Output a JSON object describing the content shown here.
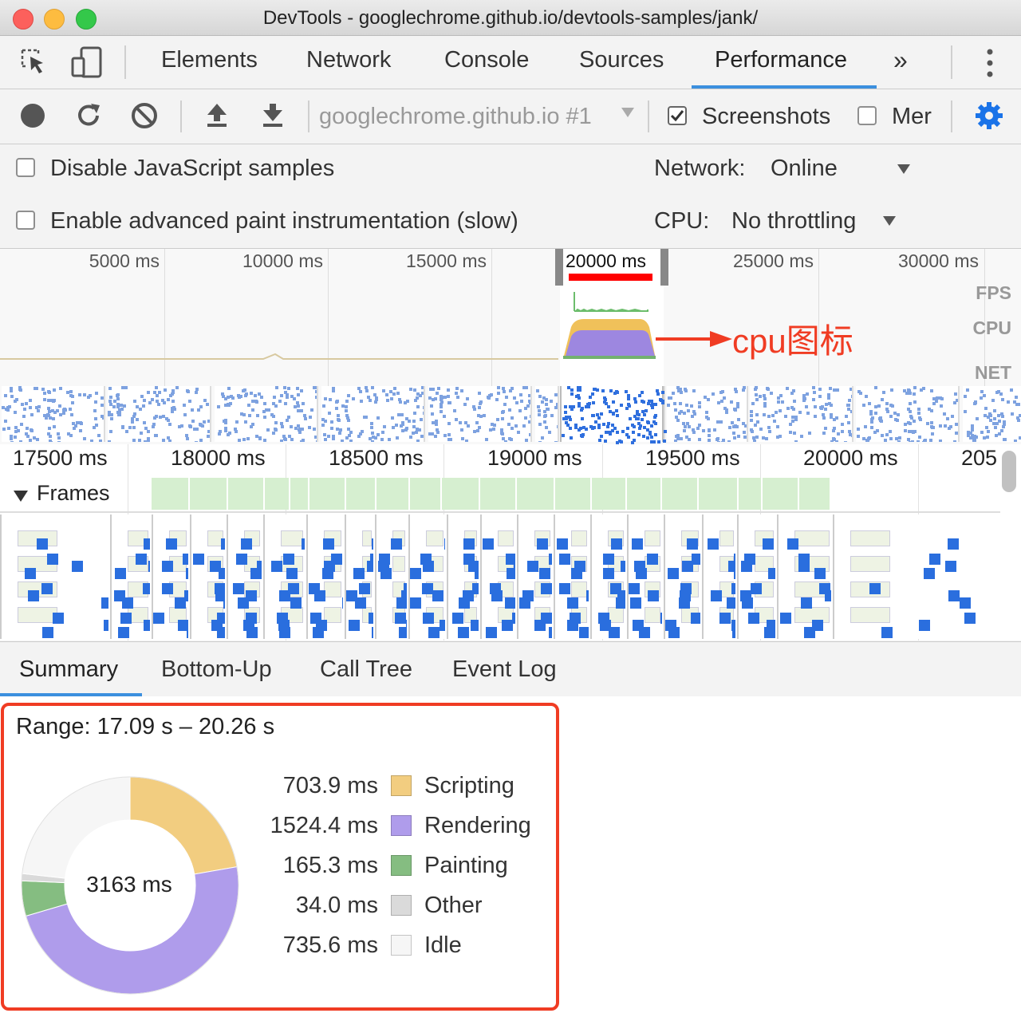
{
  "window": {
    "title": "DevTools - googlechrome.github.io/devtools-samples/jank/"
  },
  "tabs": [
    {
      "label": "Elements"
    },
    {
      "label": "Network"
    },
    {
      "label": "Console"
    },
    {
      "label": "Sources"
    },
    {
      "label": "Performance",
      "active": true
    }
  ],
  "tabbar": {
    "more_label": "»"
  },
  "toolbar": {
    "profile_select": "googlechrome.github.io #1",
    "screenshots_label": "Screenshots",
    "screenshots_checked": true,
    "memory_label": "Mer",
    "memory_checked": false
  },
  "settings": {
    "disable_js_samples": "Disable JavaScript samples",
    "advanced_paint": "Enable advanced paint instrumentation (slow)",
    "network_label": "Network:",
    "network_value": "Online",
    "cpu_label": "CPU:",
    "cpu_value": "No throttling"
  },
  "overview": {
    "ticks": [
      "5000 ms",
      "10000 ms",
      "15000 ms",
      "20000 ms",
      "25000 ms",
      "30000 ms"
    ],
    "tracks": [
      "FPS",
      "CPU",
      "NET"
    ],
    "annotation": "cpu图标"
  },
  "timeline": {
    "ticks": [
      "17500 ms",
      "18000 ms",
      "18500 ms",
      "19000 ms",
      "19500 ms",
      "20000 ms",
      "205"
    ],
    "frames_label": "Frames"
  },
  "summary_tabs": [
    {
      "label": "Summary",
      "active": true
    },
    {
      "label": "Bottom-Up"
    },
    {
      "label": "Call Tree"
    },
    {
      "label": "Event Log"
    }
  ],
  "summary": {
    "range": "Range: 17.09 s – 20.26 s",
    "total": "3163 ms",
    "items": [
      {
        "value": "703.9 ms",
        "name": "Scripting",
        "ms": 703.9,
        "color": "#f2cd80"
      },
      {
        "value": "1524.4 ms",
        "name": "Rendering",
        "ms": 1524.4,
        "color": "#af9ceb"
      },
      {
        "value": "165.3 ms",
        "name": "Painting",
        "ms": 165.3,
        "color": "#85bd81"
      },
      {
        "value": "34.0 ms",
        "name": "Other",
        "ms": 34.0,
        "color": "#dadada"
      },
      {
        "value": "735.6 ms",
        "name": "Idle",
        "ms": 735.6,
        "color": "#f6f6f6"
      }
    ]
  },
  "colors": {
    "accent": "#1a73e8",
    "annotation_red": "#f03c23",
    "active_tab_underline": "#3b8fde"
  }
}
